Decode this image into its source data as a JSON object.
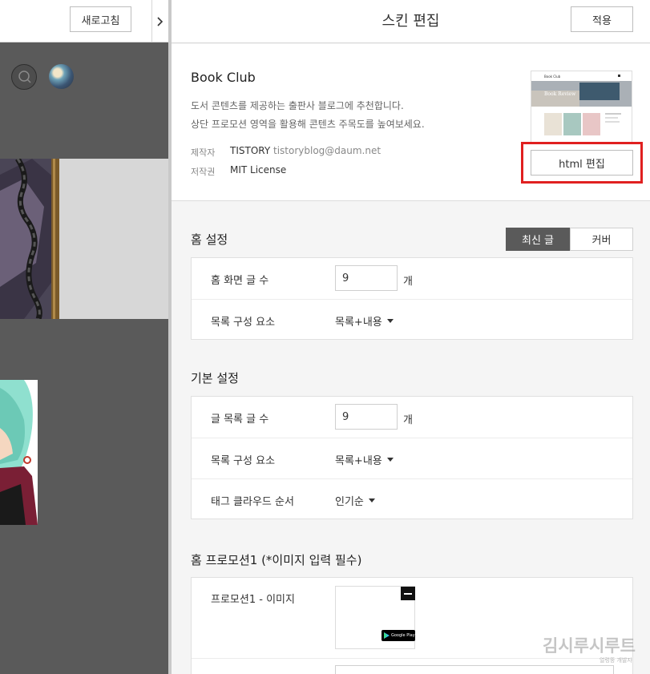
{
  "left_pane": {
    "refresh_label": "새로고침",
    "toggle_icon": "chevron-right-icon",
    "search_icon": "search-icon"
  },
  "header": {
    "title": "스킨 편집",
    "apply_label": "적용"
  },
  "skin": {
    "name": "Book Club",
    "description_line1": "도서 콘텐츠를 제공하는 출판사 블로그에 추천합니다.",
    "description_line2": "상단 프로모션 영역을 활용해 콘텐츠 주목도를 높여보세요.",
    "author_label": "제작자",
    "author_name": "TISTORY",
    "author_email": "tistoryblog@daum.net",
    "license_label": "저작권",
    "license_value": "MIT License",
    "html_edit_label": "html 편집",
    "thumbnail_title": "Book Club",
    "thumbnail_banner": "Book Review"
  },
  "home_settings": {
    "title": "홈 설정",
    "tabs": [
      "최신 글",
      "커버"
    ],
    "active_tab": "최신 글",
    "rows": [
      {
        "label": "홈 화면 글 수",
        "value": "9",
        "unit": "개"
      },
      {
        "label": "목록 구성 요소",
        "value": "목록+내용"
      }
    ]
  },
  "basic_settings": {
    "title": "기본 설정",
    "rows": [
      {
        "label": "글 목록 글 수",
        "value": "9",
        "unit": "개"
      },
      {
        "label": "목록 구성 요소",
        "value": "목록+내용"
      },
      {
        "label": "태그 클라우드 순서",
        "value": "인기순"
      }
    ]
  },
  "promotion1": {
    "title": "홈 프로모션1 (*이미지 입력 필수)",
    "image_label": "프로모션1 - 이미지",
    "badge_text": "Google Play"
  },
  "watermark": {
    "text": "김시루시루트",
    "sub": "얼렁뚱 개발자"
  },
  "colors": {
    "highlight": "#e02020",
    "active_tab_bg": "#5a5a5a",
    "preview_bg": "#5a5a5a"
  }
}
